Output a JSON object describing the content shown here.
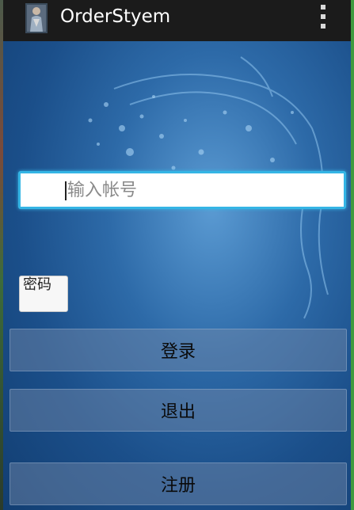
{
  "app": {
    "title": "OrderStyem",
    "icon": "app-figure-icon"
  },
  "actionbar": {
    "overflow_icon": "overflow-menu-icon"
  },
  "form": {
    "account_placeholder": "输入帐号",
    "account_value": "",
    "password_label": "密码"
  },
  "buttons": {
    "login": "登录",
    "exit": "退出",
    "register": "注册"
  },
  "colors": {
    "actionbar": "#1b1b1b",
    "focus_border": "#35b5e5",
    "background_blue": "#2d6aa8"
  }
}
